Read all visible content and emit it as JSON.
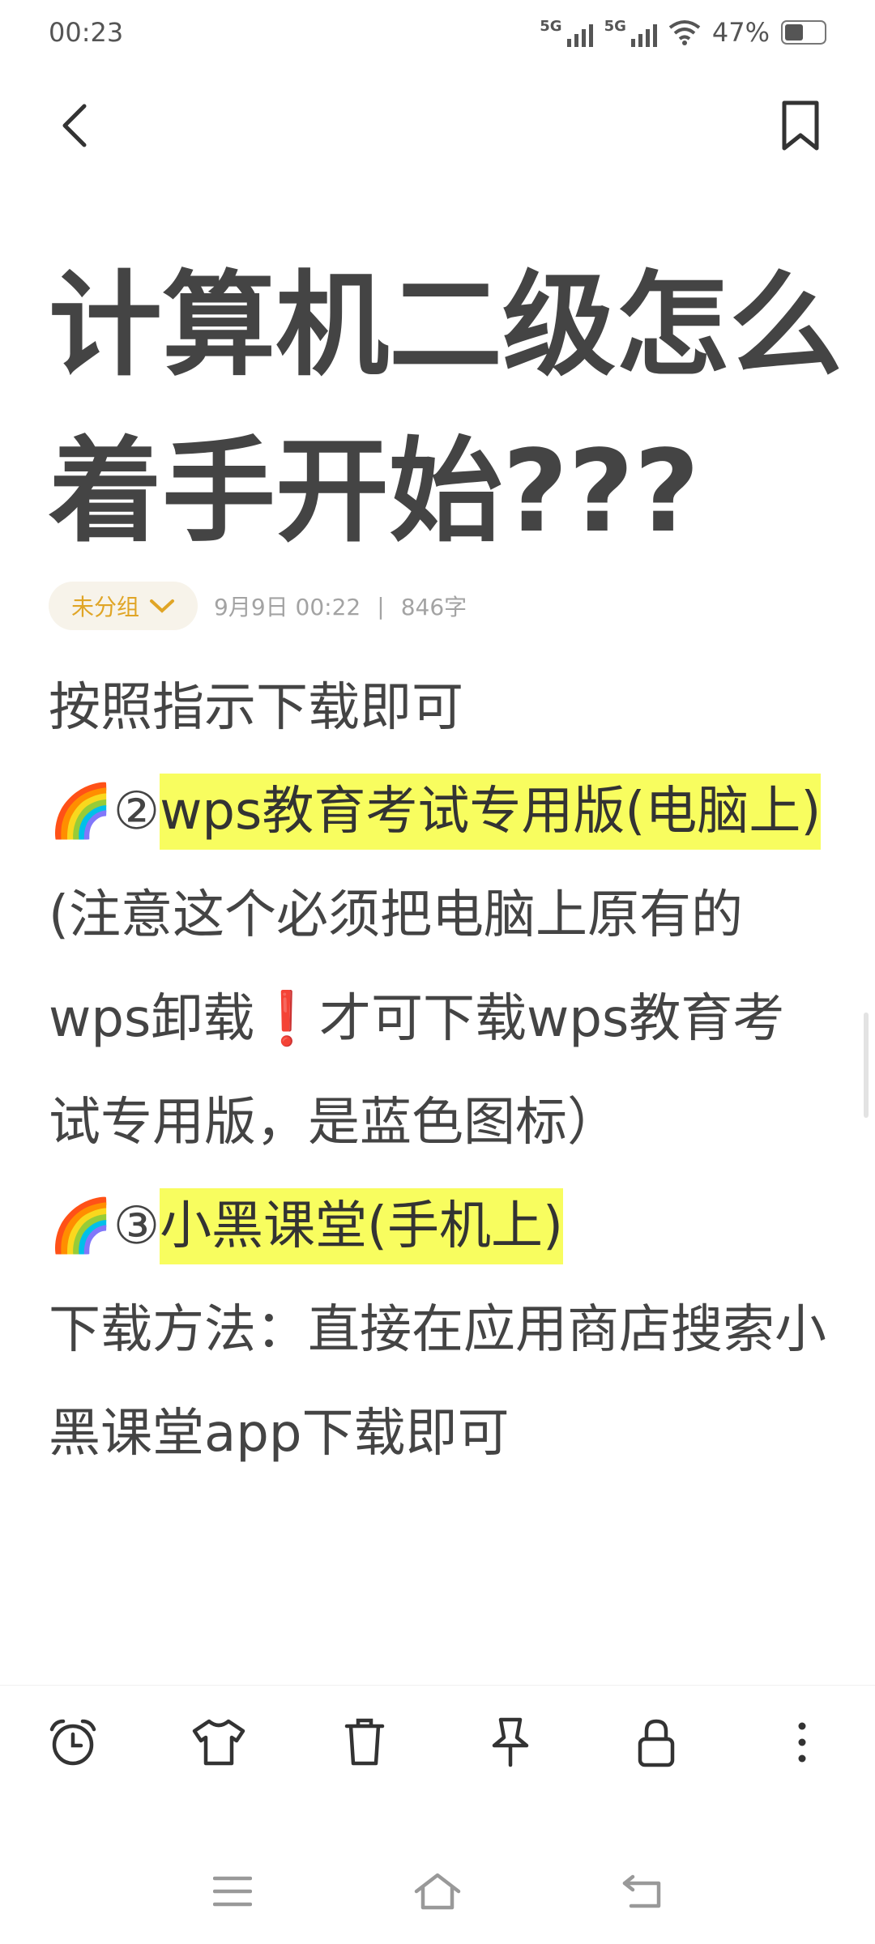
{
  "status": {
    "time": "00:23",
    "signal1": "5G",
    "signal2": "5G",
    "battery": "47%",
    "battery_level": 0.47
  },
  "note": {
    "title": "计算机二级怎么着手开始???",
    "group": "未分组",
    "date": "9月9日 00:22",
    "separator": "|",
    "word_count": "846字",
    "lines": {
      "l1": "按照指示下载即可",
      "l2_emoji": "🌈②",
      "l2_highlight": "wps教育考试专用版(电脑上)",
      "l3a": "(注意这个必须把电脑上原有的wps卸载",
      "l3_mark": "❗",
      "l3b": "才可下载wps教育考试专用版，是蓝色图标）",
      "l4_emoji": "🌈③",
      "l4_highlight": "小黑课堂(手机上)",
      "l5": "下载方法：直接在应用商店搜索小黑课堂app下载即可"
    }
  },
  "icons": {
    "back": "chevron-left-icon",
    "bookmark": "bookmark-icon",
    "alarm": "alarm-clock-icon",
    "skin": "tshirt-icon",
    "delete": "trash-icon",
    "pin": "pin-icon",
    "lock": "lock-icon",
    "more": "more-vertical-icon"
  },
  "colors": {
    "accent": "#e0a526",
    "highlight": "#f8fd5f",
    "text": "#444444"
  }
}
